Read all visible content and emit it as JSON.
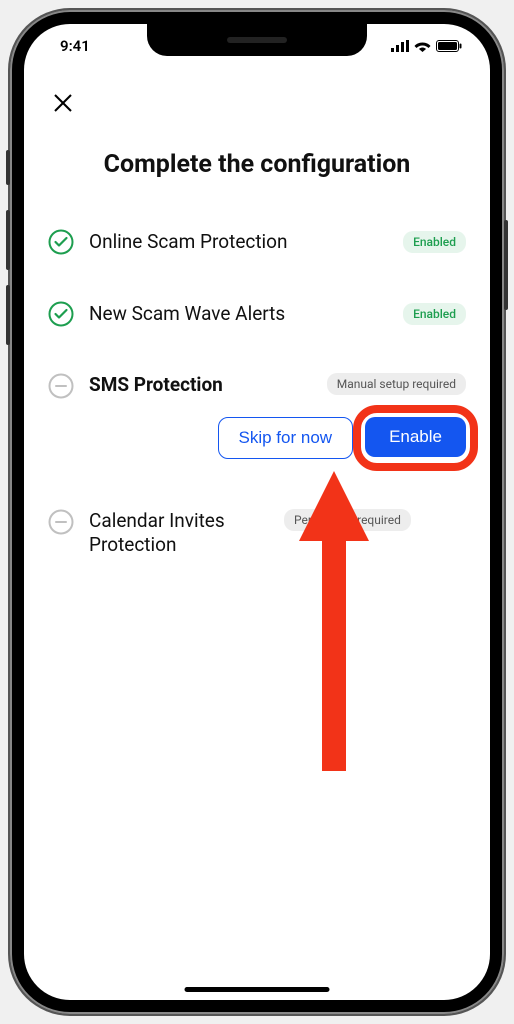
{
  "statusBar": {
    "time": "9:41"
  },
  "close": "✕",
  "title": "Complete the configuration",
  "items": [
    {
      "label": "Online Scam Protection",
      "badge": "Enabled"
    },
    {
      "label": "New Scam Wave Alerts",
      "badge": "Enabled"
    },
    {
      "label": "SMS Protection",
      "badge": "Manual setup required"
    },
    {
      "label": "Calendar Invites Protection",
      "badge": "Permission required"
    }
  ],
  "actions": {
    "skip": "Skip for now",
    "enable": "Enable"
  }
}
